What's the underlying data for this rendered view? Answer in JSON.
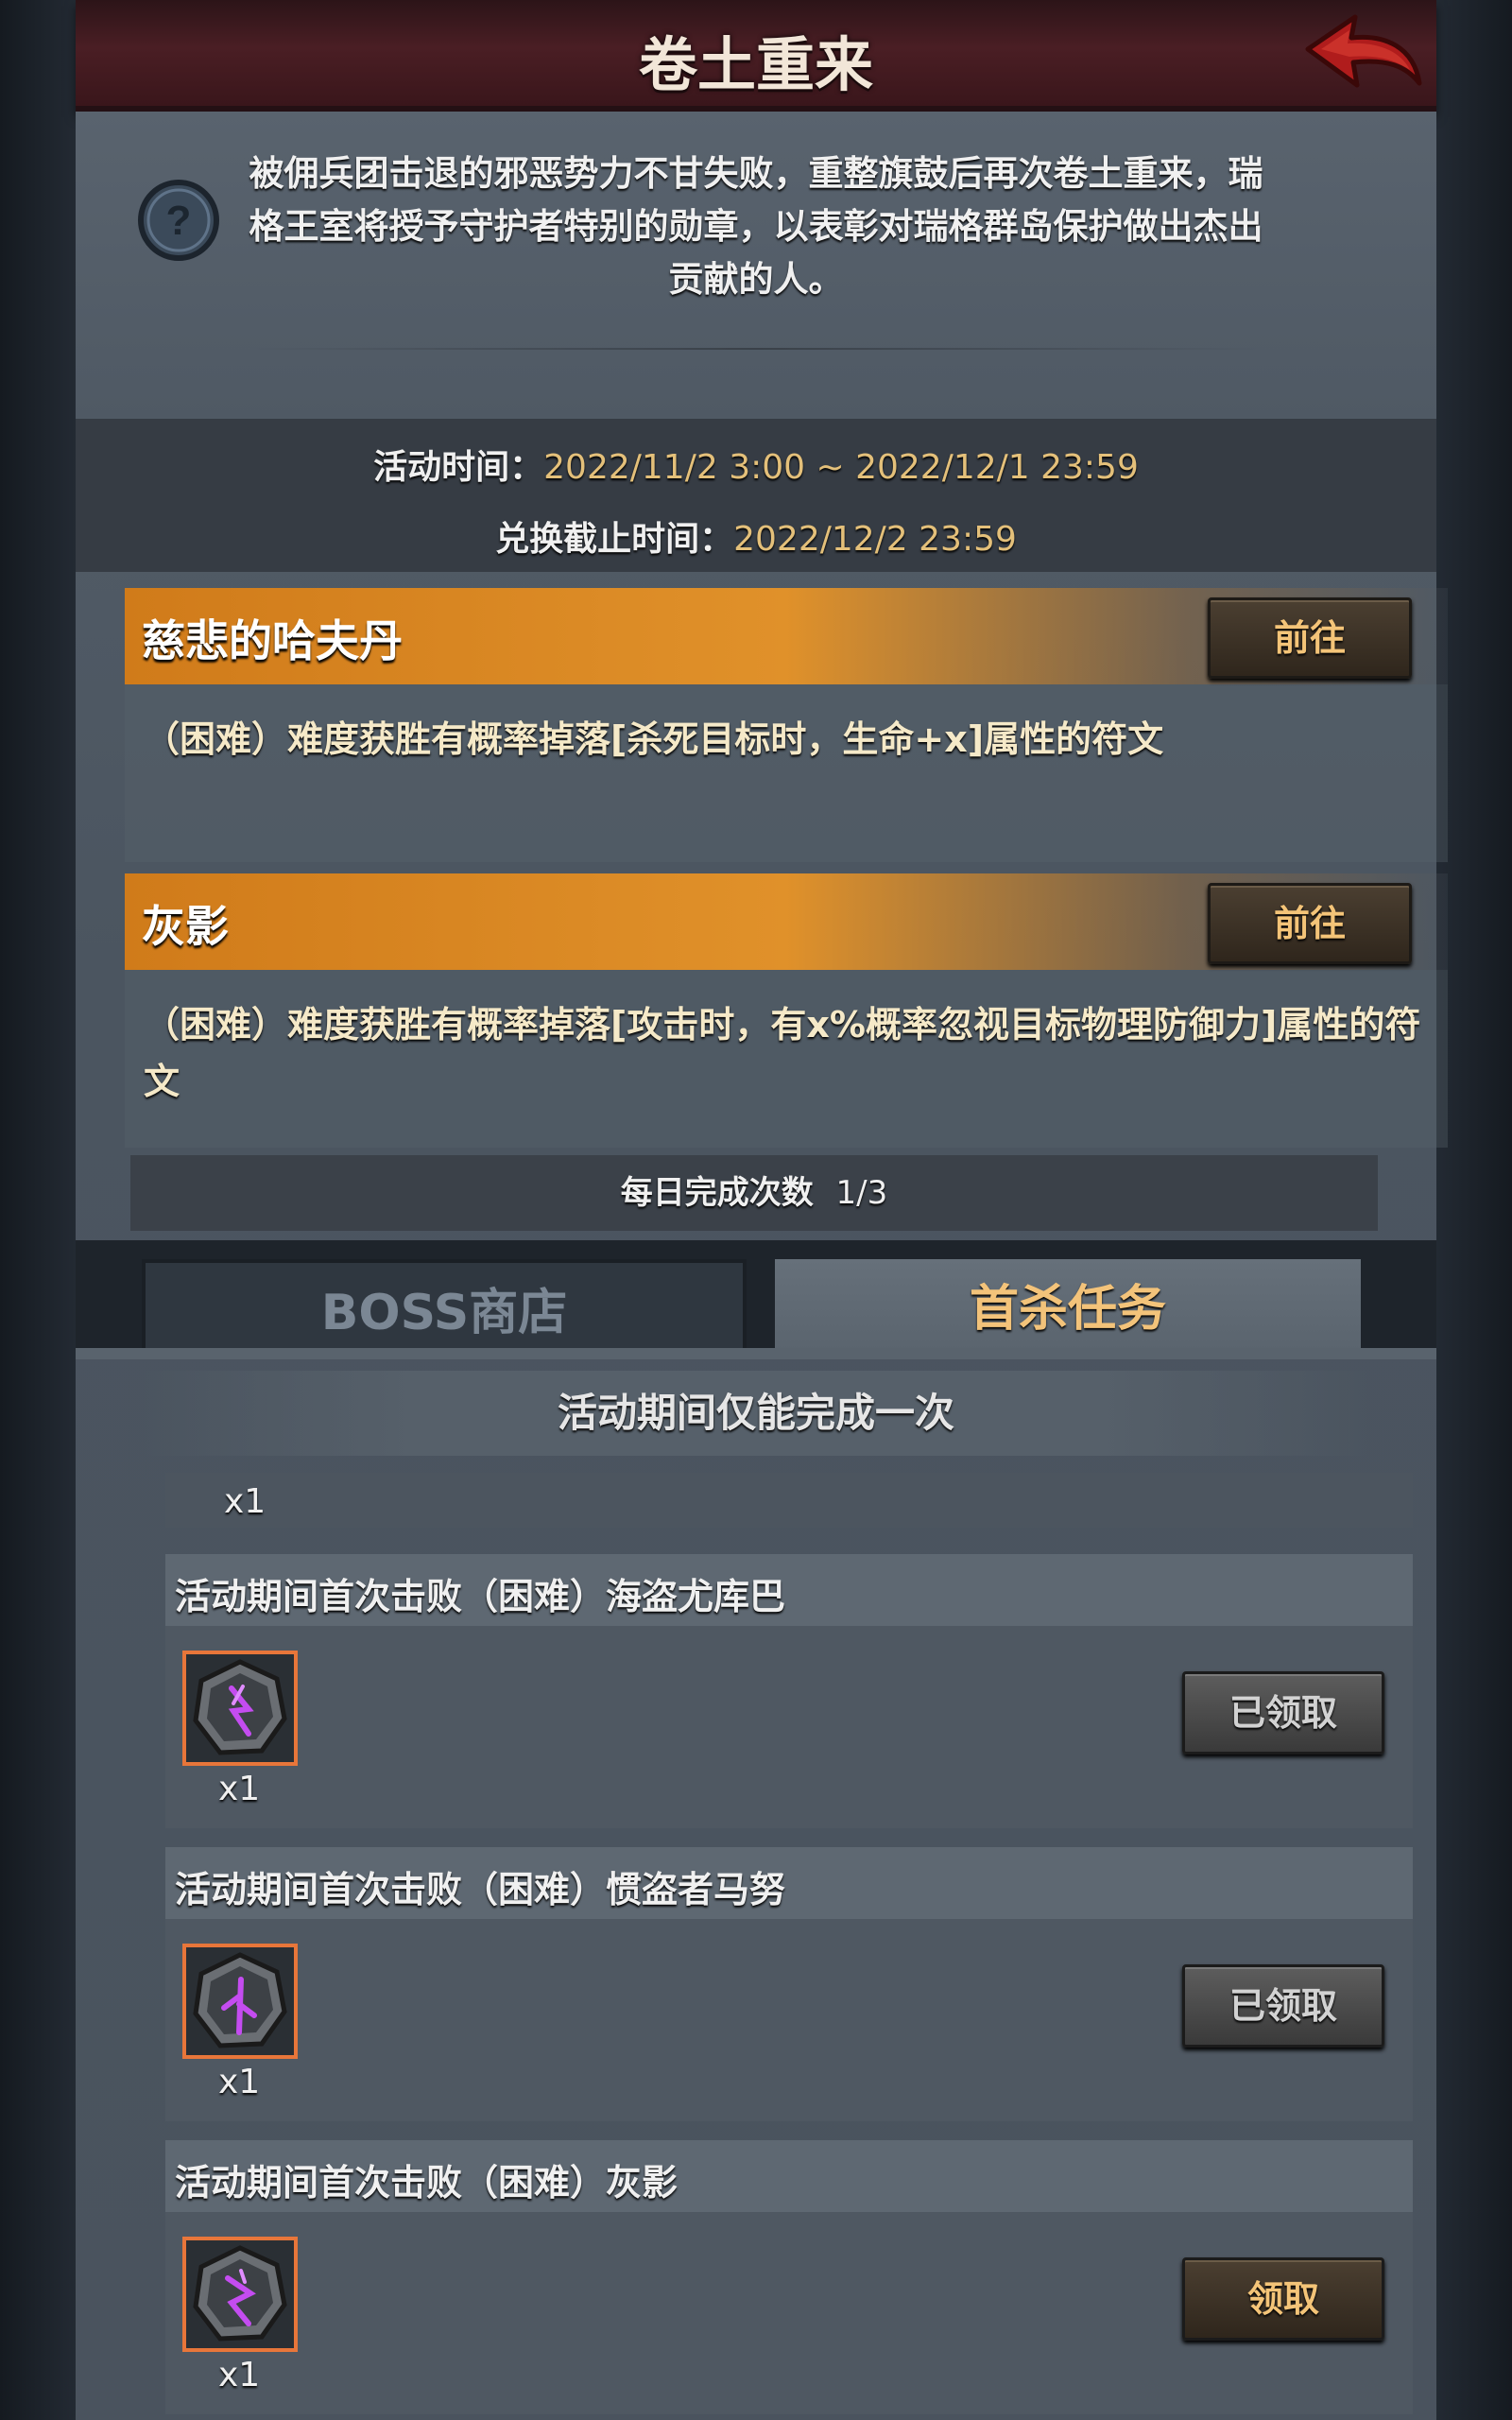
{
  "header": {
    "title": "卷土重来"
  },
  "description": "被佣兵团击退的邪恶势力不甘失败，重整旗鼓后再次卷土重来，瑞格王室将授予守护者特别的勋章，以表彰对瑞格群岛保护做出杰出贡献的人。",
  "times": {
    "activity_label": "活动时间：",
    "activity_value": "2022/11/2 3:00 ~ 2022/12/1 23:59",
    "exchange_label": "兑换截止时间：",
    "exchange_value": "2022/12/2 23:59"
  },
  "bosses": [
    {
      "name": "慈悲的哈夫丹",
      "button": "前往",
      "desc": "（困难）难度获胜有概率掉落[杀死目标时，生命+x]属性的符文"
    },
    {
      "name": "灰影",
      "button": "前往",
      "desc": "（困难）难度获胜有概率掉落[攻击时，有x%概率忽视目标物理防御力]属性的符文"
    }
  ],
  "daily": {
    "label": "每日完成次数",
    "value": "1/3"
  },
  "tabs": {
    "shop": "BOSS商店",
    "quest": "首杀任务"
  },
  "quest_section": {
    "title": "活动期间仅能完成一次",
    "top_qty": "x1"
  },
  "quests": [
    {
      "name": "活动期间首次击败（困难）海盗尤库巴",
      "qty": "x1",
      "button": "已领取",
      "state": "done"
    },
    {
      "name": "活动期间首次击败（困难）惯盗者马努",
      "qty": "x1",
      "button": "已领取",
      "state": "done"
    },
    {
      "name": "活动期间首次击败（困难）灰影",
      "qty": "x1",
      "button": "领取",
      "state": "ready"
    }
  ],
  "colors": {
    "accent_orange": "#e0912a",
    "gold_text": "#e4c07a",
    "item_border": "#e8763a",
    "header_red": "#4a1e24",
    "back_arrow": "#b01c1c"
  },
  "icons": {
    "back": "back-arrow-icon",
    "help": "question-icon",
    "rune": "rune-stone-icon"
  }
}
